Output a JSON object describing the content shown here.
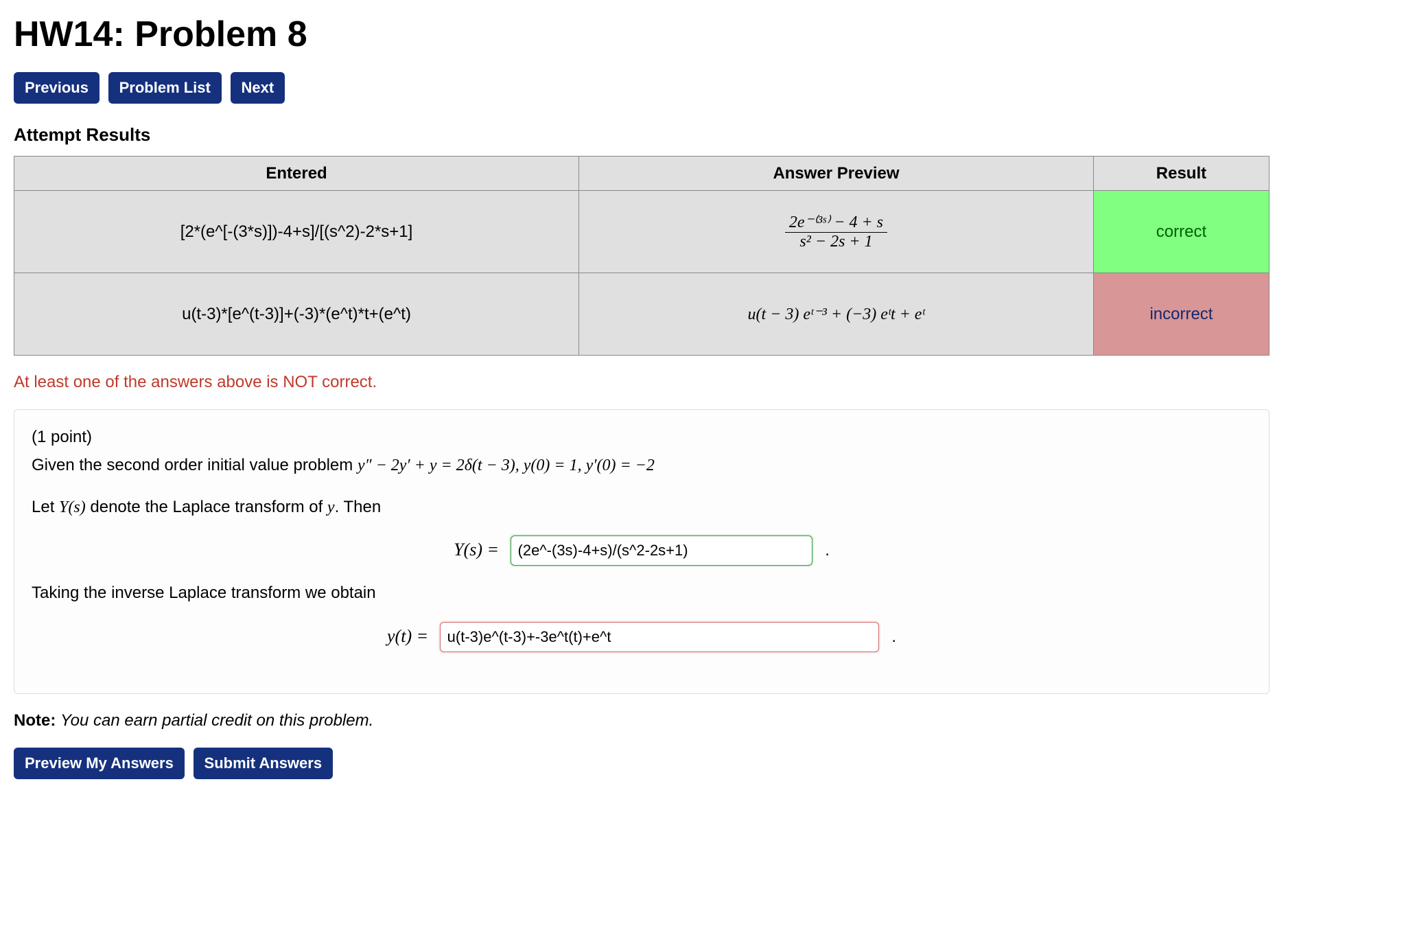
{
  "title": "HW14: Problem 8",
  "nav": {
    "prev": "Previous",
    "list": "Problem List",
    "next": "Next"
  },
  "attempt_heading": "Attempt Results",
  "table": {
    "headers": {
      "entered": "Entered",
      "preview": "Answer Preview",
      "result": "Result"
    },
    "rows": [
      {
        "entered": "[2*(e^[-(3*s)])-4+s]/[(s^2)-2*s+1]",
        "preview_num": "2e⁻⁽³ˢ⁾ − 4 + s",
        "preview_den": "s² − 2s + 1",
        "result": "correct",
        "status": "correct"
      },
      {
        "entered": "u(t-3)*[e^(t-3)]+(-3)*(e^t)*t+(e^t)",
        "preview_flat": "u(t − 3) eᵗ⁻³ + (−3) eᵗt + eᵗ",
        "result": "incorrect",
        "status": "incorrect"
      }
    ]
  },
  "warning": "At least one of the answers above is NOT correct.",
  "problem": {
    "points": "(1 point)",
    "line1a": "Given the second order initial value problem ",
    "line1b_math": "y″ − 2y′ + y = 2δ(t − 3),   y(0) = 1,   y′(0) = −2",
    "line2a": "Let ",
    "line2b_math": "Y(s)",
    "line2c": " denote the Laplace transform of ",
    "line2d_math": "y",
    "line2e": ". Then",
    "eq1_label": "Y(s) = ",
    "eq1_value": "(2e^-(3s)-4+s)/(s^2-2s+1)",
    "line3": "Taking the inverse Laplace transform we obtain",
    "eq2_label": "y(t) = ",
    "eq2_value": "u(t-3)e^(t-3)+-3e^t(t)+e^t",
    "period": "."
  },
  "note": {
    "bold": "Note:",
    "text": " You can earn partial credit on this problem."
  },
  "actions": {
    "preview": "Preview My Answers",
    "submit": "Submit Answers"
  }
}
